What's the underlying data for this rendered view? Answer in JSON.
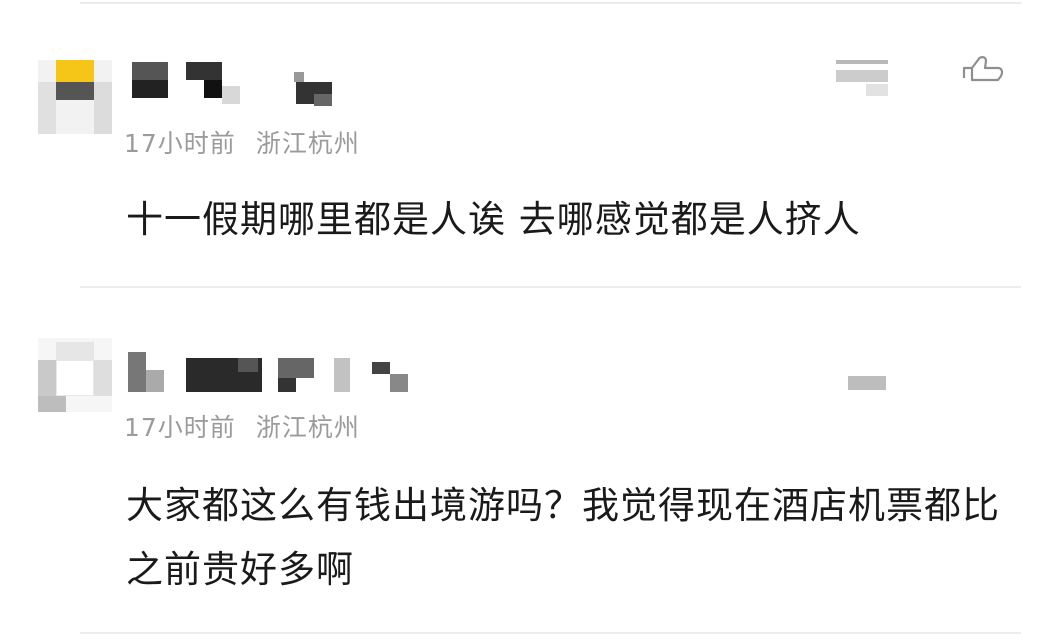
{
  "comments": [
    {
      "meta": {
        "time": "17小时前",
        "location": "浙江杭州"
      },
      "text": "十一假期哪里都是人诶 去哪感觉都是人挤人",
      "icons": {
        "menu": "menu-icon",
        "like": "thumbs-up-icon"
      }
    },
    {
      "meta": {
        "time": "17小时前",
        "location": "浙江杭州"
      },
      "text": "大家都这么有钱出境游吗？我觉得现在酒店机票都比之前贵好多啊",
      "icons": {
        "menu": "menu-icon"
      }
    }
  ],
  "colors": {
    "meta": "#9b9b9b",
    "text": "#1a1a1a",
    "divider": "#ececec",
    "avatar_accent": "#f5c518"
  }
}
